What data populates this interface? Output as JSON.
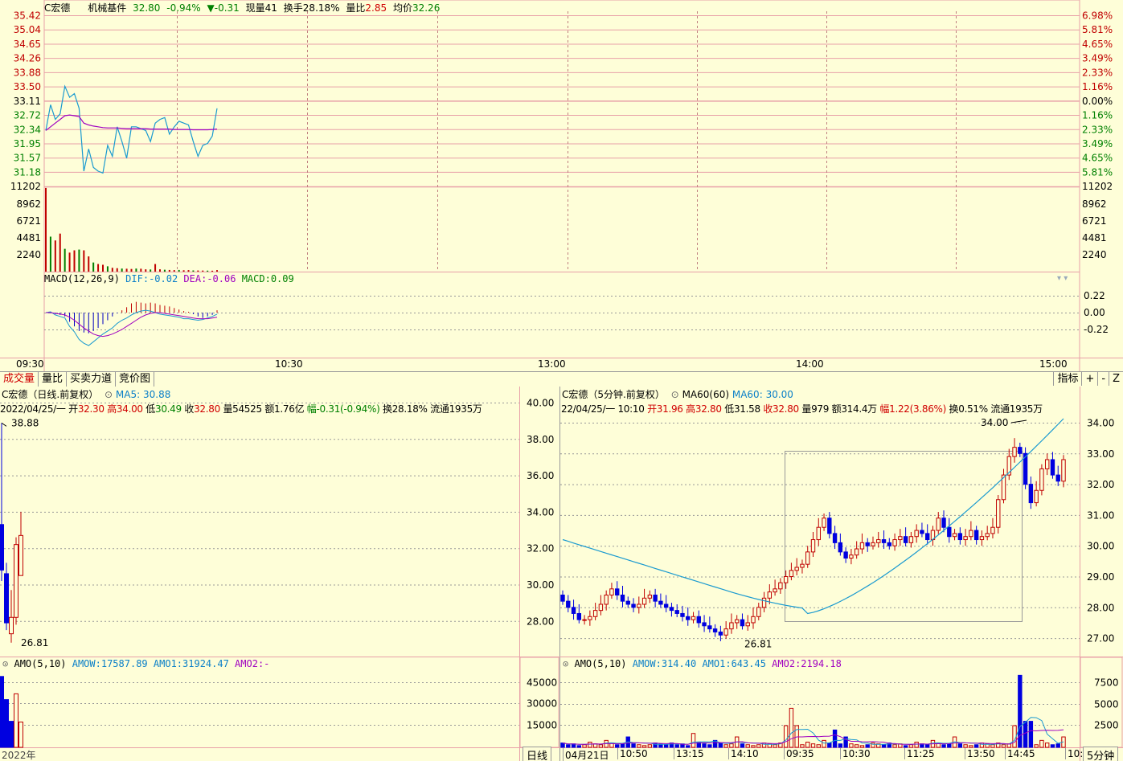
{
  "intraday": {
    "name": "C宏德",
    "sector": "机械基件",
    "price": "32.80",
    "pct": "-0.94%",
    "change_arrow": "▼",
    "change": "-0.31",
    "vol_label": "现量",
    "vol_value": "41",
    "turn_label": "换手",
    "turn_value": "28.18%",
    "ratio_label": "量比",
    "ratio_value": "2.85",
    "avg_label": "均价",
    "avg_value": "32.26",
    "price_left_ticks": [
      "35.42",
      "35.04",
      "34.65",
      "34.26",
      "33.88",
      "33.50",
      "33.11",
      "32.72",
      "32.34",
      "31.95",
      "31.57",
      "31.18"
    ],
    "pct_right_ticks": [
      "6.98%",
      "5.81%",
      "4.65%",
      "3.49%",
      "2.33%",
      "1.16%",
      "0.00%",
      "1.16%",
      "2.33%",
      "3.49%",
      "4.65%",
      "5.81%"
    ],
    "vol_ticks": [
      "11202",
      "8962",
      "6721",
      "4481",
      "2240"
    ],
    "macd_label": "MACD(12,26,9)",
    "dif_label": "DIF:",
    "dif_value": "-0.02",
    "dea_label": "DEA:",
    "dea_value": "-0.06",
    "macd_val_label": "MACD:",
    "macd_value": "0.09",
    "macd_ticks": [
      "0.22",
      "0.00",
      "-0.22"
    ],
    "time_labels": [
      "09:30",
      "10:30",
      "13:00",
      "14:00",
      "15:00"
    ],
    "colors": {
      "price_line": "#1a9ad0",
      "avg_line": "#a000c0",
      "up": "#c00000",
      "down": "#008000"
    }
  },
  "tabs": [
    "成交量",
    "量比",
    "买卖力道",
    "竞价图"
  ],
  "tabbar_right": [
    "指标",
    "+",
    "-",
    "Z"
  ],
  "daily": {
    "title": "C宏德（日线.前复权）",
    "ma_label": "MA5:",
    "ma_value": "30.88",
    "date": "2022/04/25/一",
    "open_label": "开",
    "open": "32.30",
    "high_label": "高",
    "high": "34.00",
    "low_label": "低",
    "low": "30.49",
    "close_label": "收",
    "close": "32.80",
    "vol_label": "量",
    "vol": "54525",
    "amt_label": "额",
    "amt": "1.76亿",
    "range_label": "幅",
    "range": "-0.31(-0.94%)",
    "turn_label": "换",
    "turn": "28.18%",
    "float_label": "流通",
    "float": "1935万",
    "high_mark": "38.88",
    "low_mark": "26.81",
    "y_ticks": [
      "40.00",
      "38.00",
      "36.00",
      "34.00",
      "32.00",
      "30.00",
      "28.00"
    ],
    "amo_label": "AMO(5,10)",
    "amow_label": "AMOW:",
    "amow": "17587.89",
    "amo1_label": "AMO1:",
    "amo1": "31924.47",
    "amo2_label": "AMO2:",
    "amo2": "-",
    "amo_ticks": [
      "45000",
      "30000",
      "15000"
    ],
    "year_label": "2022年",
    "period_label": "日线"
  },
  "min5": {
    "title": "C宏德（5分钟.前复权）",
    "ma_label": "MA60(60)",
    "ma60_label": "MA60:",
    "ma60_value": "30.00",
    "date": "22/04/25/一",
    "time": "10:10",
    "open_label": "开",
    "open": "31.96",
    "high_label": "高",
    "high": "32.80",
    "low_label": "低",
    "low": "31.58",
    "close_label": "收",
    "close": "32.80",
    "vol_label": "量",
    "vol": "979",
    "amt_label": "额",
    "amt": "314.4万",
    "range_label": "幅",
    "range": "1.22(3.86%)",
    "turn_label": "换",
    "turn": "0.51%",
    "float_label": "流通",
    "float": "1935万",
    "high_mark": "34.00",
    "low_mark": "26.81",
    "y_ticks": [
      "34.00",
      "33.00",
      "32.00",
      "31.00",
      "30.00",
      "29.00",
      "28.00",
      "27.00"
    ],
    "amo_label": "AMO(5,10)",
    "amow_label": "AMOW:",
    "amow": "314.40",
    "amo1_label": "AMO1:",
    "amo1": "643.45",
    "amo2_label": "AMO2:",
    "amo2": "2194.18",
    "amo_ticks": [
      "7500",
      "5000",
      "2500"
    ],
    "time_labels": [
      "04月21日",
      "10:50",
      "13:15",
      "14:10",
      "09:35",
      "10:30",
      "11:25",
      "13:50",
      "14:45",
      "10:"
    ],
    "period_label": "5分钟"
  },
  "chart_data": [
    {
      "type": "line",
      "title": "",
      "series": [
        {
          "name": "",
          "values": [
            32.3,
            33.0,
            32.6,
            32.75,
            33.5,
            33.2,
            33.3,
            32.9,
            31.2,
            31.8,
            31.3,
            31.2,
            31.15,
            31.9,
            31.6,
            32.4,
            32.0,
            31.55,
            32.4,
            32.4,
            32.35,
            32.3,
            32.0,
            32.5,
            32.6,
            32.65,
            32.2,
            32.4,
            32.55,
            32.5,
            32.45,
            32.0,
            31.6,
            31.9,
            31.95,
            32.15,
            32.9
          ]
        },
        {
          "name": "",
          "values": [
            32.3,
            32.4,
            32.5,
            32.6,
            32.7,
            32.72,
            32.7,
            32.68,
            32.5,
            32.45,
            32.42,
            32.4,
            32.38,
            32.37,
            32.37,
            32.37,
            32.36,
            32.35,
            32.35,
            32.35,
            32.35,
            32.35,
            32.34,
            32.34,
            32.34,
            32.34,
            32.34,
            32.33,
            32.33,
            32.33,
            32.33,
            32.32,
            32.32,
            32.32,
            32.32,
            32.33,
            32.34
          ]
        }
      ],
      "ylim": [
        31.18,
        35.42
      ]
    }
  ]
}
